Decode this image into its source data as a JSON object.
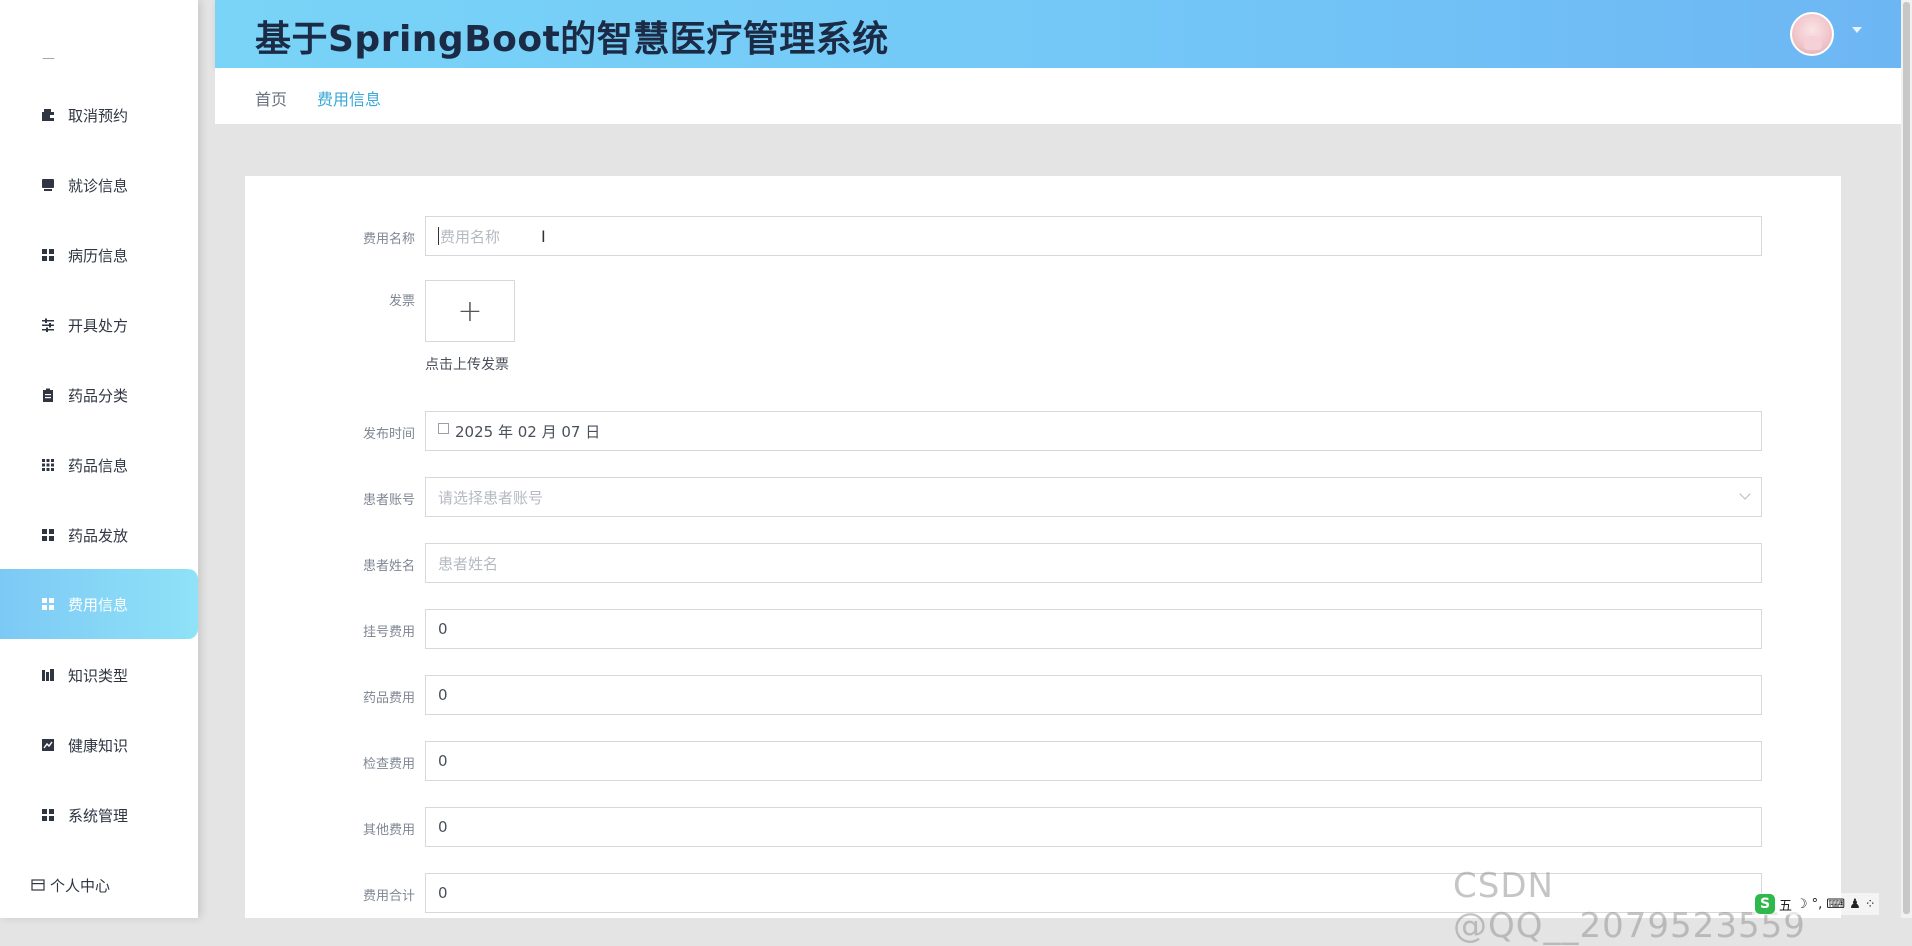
{
  "sidebar": {
    "top_mark": "—",
    "items": [
      {
        "label": "取消预约",
        "icon": "wallet-icon"
      },
      {
        "label": "就诊信息",
        "icon": "monitor-icon"
      },
      {
        "label": "病历信息",
        "icon": "grid-icon"
      },
      {
        "label": "开具处方",
        "icon": "sliders-icon"
      },
      {
        "label": "药品分类",
        "icon": "clipboard-icon"
      },
      {
        "label": "药品信息",
        "icon": "dots-grid-icon"
      },
      {
        "label": "药品发放",
        "icon": "grid-icon"
      },
      {
        "label": "费用信息",
        "icon": "grid-icon",
        "active": true
      },
      {
        "label": "知识类型",
        "icon": "books-icon"
      },
      {
        "label": "健康知识",
        "icon": "chart-icon"
      },
      {
        "label": "系统管理",
        "icon": "grid-icon"
      }
    ],
    "personal": {
      "label": "个人中心",
      "icon": "card-icon"
    },
    "active_color": "#7dc9f6"
  },
  "header": {
    "title": "基于SpringBoot的智慧医疗管理系统",
    "gradient_start": "#79d4f7",
    "gradient_end": "#6db6f4"
  },
  "breadcrumb": {
    "home": "首页",
    "current": "费用信息"
  },
  "form": {
    "fee_name": {
      "label": "费用名称",
      "placeholder": "费用名称",
      "value": ""
    },
    "invoice": {
      "label": "发票",
      "button": "+",
      "hint": "点击上传发票"
    },
    "publish_time": {
      "label": "发布时间",
      "value": "2025 年 02 月 07 日"
    },
    "patient_account": {
      "label": "患者账号",
      "placeholder": "请选择患者账号"
    },
    "patient_name": {
      "label": "患者姓名",
      "placeholder": "患者姓名"
    },
    "registration_fee": {
      "label": "挂号费用",
      "value": "0"
    },
    "drug_fee": {
      "label": "药品费用",
      "value": "0"
    },
    "exam_fee": {
      "label": "检查费用",
      "value": "0"
    },
    "other_fee": {
      "label": "其他费用",
      "value": "0"
    },
    "total_fee": {
      "label": "费用合计",
      "value": "0"
    }
  },
  "watermark": "CSDN @QQ__2079523559",
  "ime": {
    "logo": "S",
    "mode": "五"
  }
}
